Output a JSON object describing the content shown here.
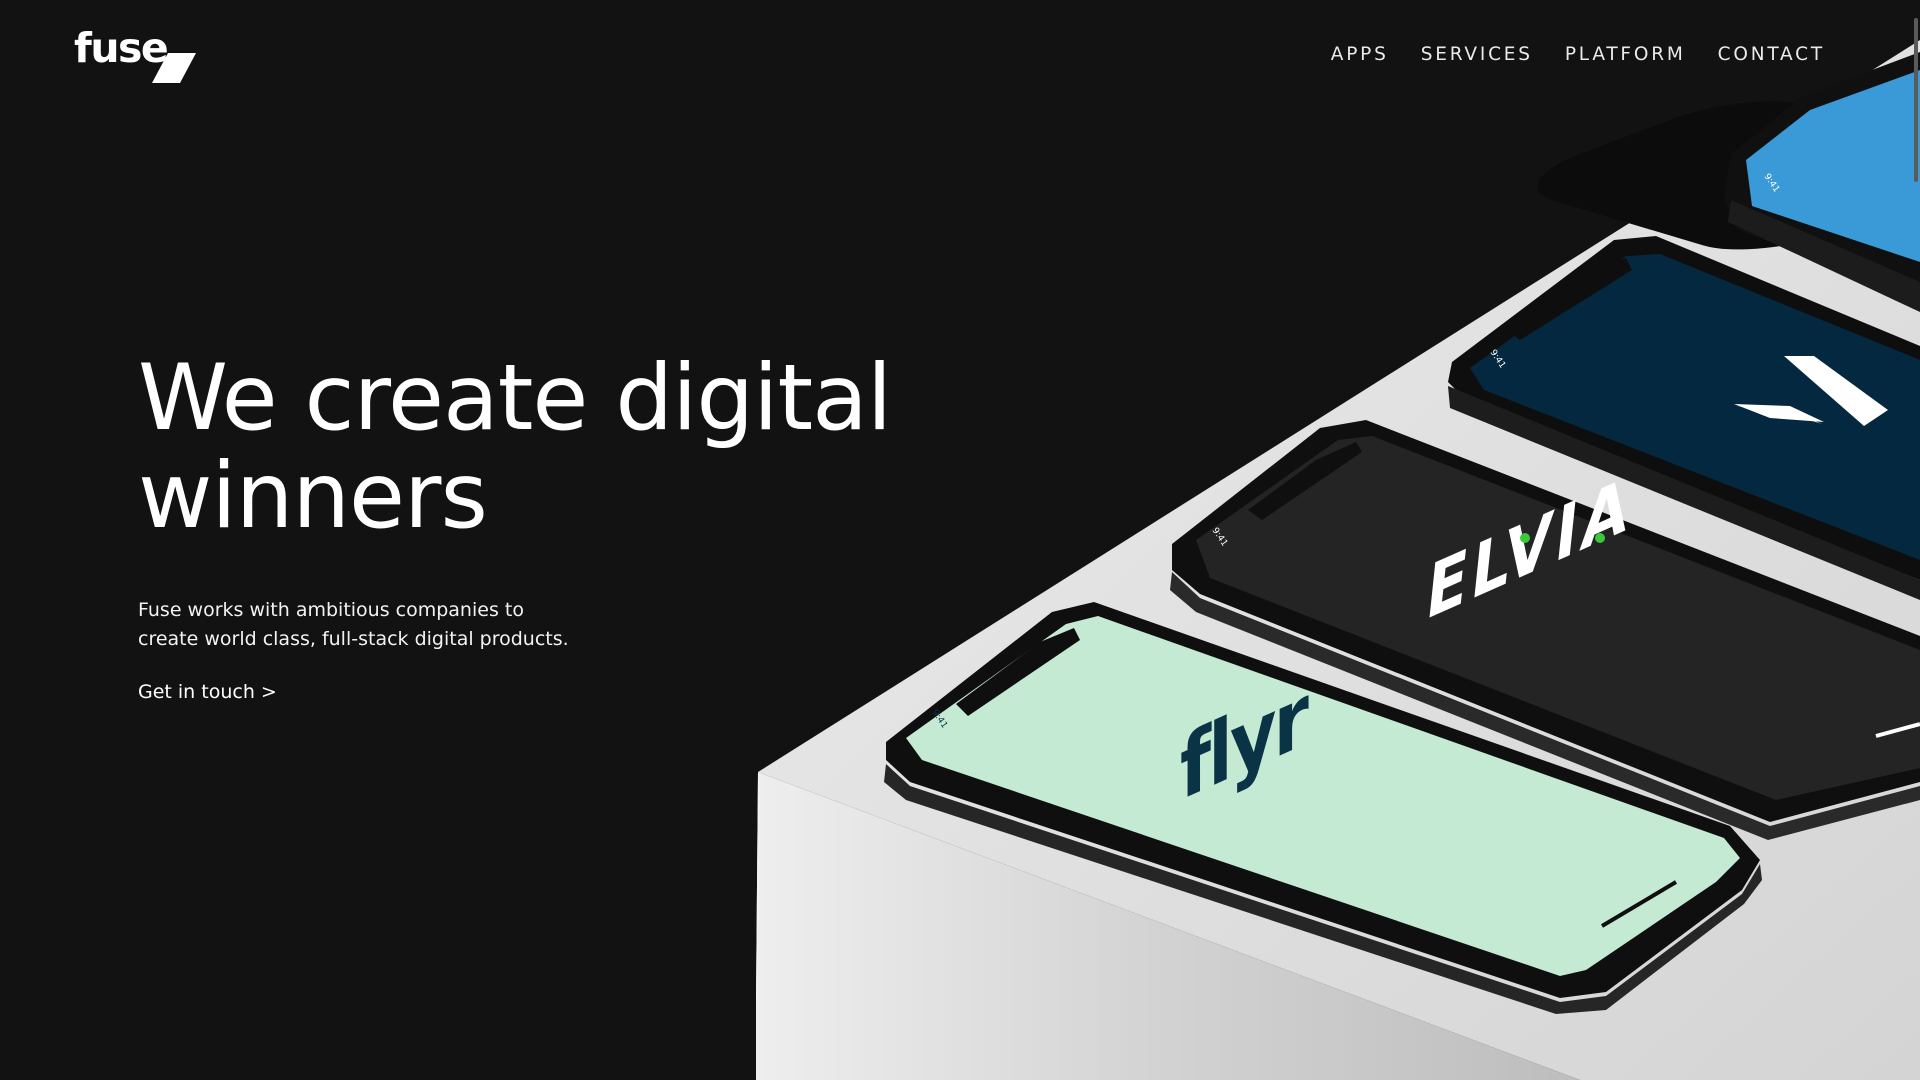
{
  "brand": {
    "logo_text": "fuse"
  },
  "nav": {
    "items": [
      "APPS",
      "SERVICES",
      "PLATFORM",
      "CONTACT"
    ]
  },
  "hero": {
    "title_line1": "We create digital",
    "title_line2": "winners",
    "subtitle_line1": "Fuse works with ambitious companies to",
    "subtitle_line2": "create world class, full-stack digital products.",
    "cta": "Get in touch >"
  },
  "phones": [
    {
      "app": "flyr",
      "time": "9:41",
      "screen_color": "#c4ead3",
      "logo_color": "#0b3346"
    },
    {
      "app": "elvia",
      "logo_text": "ELVIA",
      "time": "9:41",
      "screen_color": "#232323",
      "logo_color": "#ffffff",
      "accent": "#3ac93a"
    },
    {
      "app": "navy-v",
      "time": "9:41",
      "screen_color": "#04283f",
      "logo_color": "#ffffff"
    },
    {
      "app": "blue-app",
      "time": "9:41",
      "screen_color": "#3a9ad8"
    }
  ],
  "colors": {
    "background": "#121213",
    "text": "#ffffff",
    "platform_top": "#dedede",
    "platform_side": "#c9c9c9"
  }
}
